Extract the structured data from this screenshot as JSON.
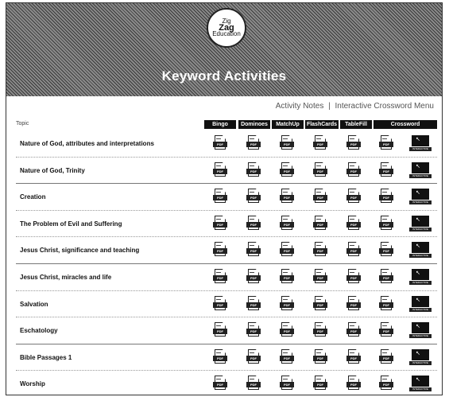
{
  "logo": {
    "line1": "Zig",
    "line2": "Zag",
    "line3": "Education"
  },
  "title": "Keyword Activities",
  "menu": {
    "item1": "Activity Notes",
    "sep": "|",
    "item2": "Interactive Crossword Menu"
  },
  "table": {
    "topic_header": "Topic",
    "columns": [
      "Bingo",
      "Dominoes",
      "MatchUp",
      "FlashCards",
      "TableFill",
      "Crossword"
    ],
    "pdf_label": "PDF",
    "crossword_label": "INTERACTIVE",
    "rows": [
      "Nature of God, attributes and interpretations",
      "Nature of God, Trinity",
      "Creation",
      "The Problem of Evil and Suffering",
      "Jesus Christ, significance and teaching",
      "Jesus Christ, miracles and life",
      "Salvation",
      "Eschatology",
      "Bible Passages 1",
      "Worship"
    ]
  },
  "icons": {
    "document": "pdf-document-icon",
    "crossword": "interactive-crossword-icon",
    "cursor": "cursor-icon"
  },
  "colors": {
    "header_bg": "#111111",
    "banner_dark": "#3a3a3a",
    "text": "#111111"
  }
}
